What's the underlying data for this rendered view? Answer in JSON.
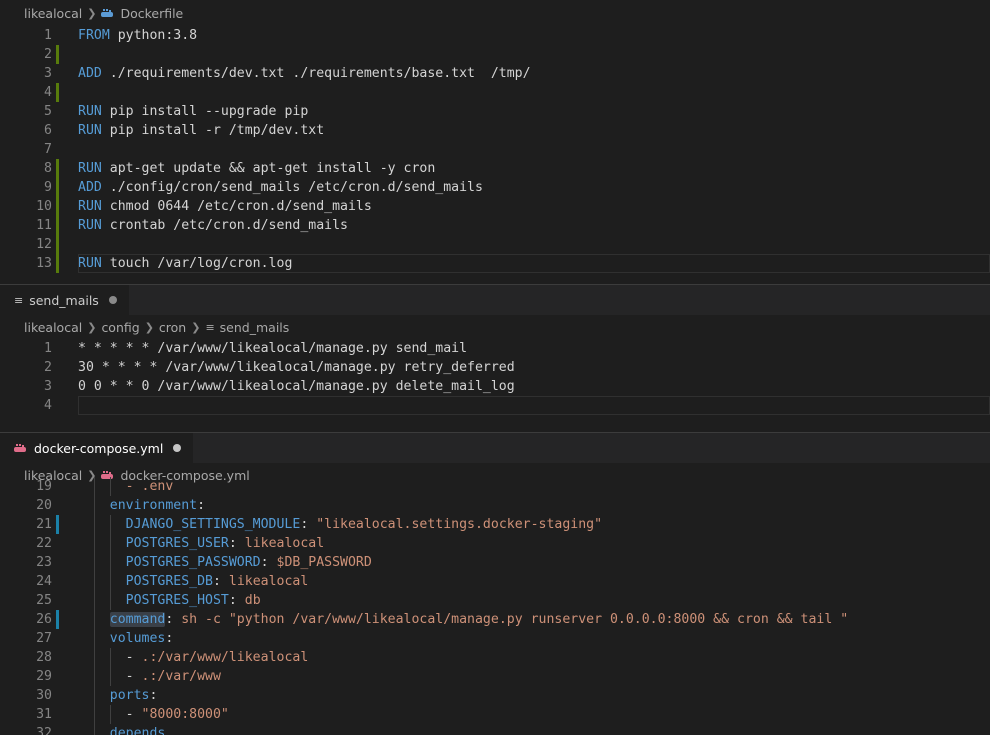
{
  "editor1": {
    "breadcrumb": {
      "folder": "likealocal",
      "file": "Dockerfile"
    },
    "lines": [
      {
        "n": "1",
        "kw": "FROM",
        "rest": " python:3.8",
        "mark": false
      },
      {
        "n": "2",
        "kw": "",
        "rest": "",
        "mark": true
      },
      {
        "n": "3",
        "kw": "ADD",
        "rest": " ./requirements/dev.txt ./requirements/base.txt  /tmp/",
        "mark": false
      },
      {
        "n": "4",
        "kw": "",
        "rest": "",
        "mark": true
      },
      {
        "n": "5",
        "kw": "RUN",
        "rest": " pip install --upgrade pip",
        "mark": false
      },
      {
        "n": "6",
        "kw": "RUN",
        "rest": " pip install -r /tmp/dev.txt",
        "mark": false
      },
      {
        "n": "7",
        "kw": "",
        "rest": "",
        "mark": false
      },
      {
        "n": "8",
        "kw": "RUN",
        "rest": " apt-get update && apt-get install -y cron",
        "mark": true
      },
      {
        "n": "9",
        "kw": "ADD",
        "rest": " ./config/cron/send_mails /etc/cron.d/send_mails",
        "mark": true
      },
      {
        "n": "10",
        "kw": "RUN",
        "rest": " chmod 0644 /etc/cron.d/send_mails",
        "mark": true
      },
      {
        "n": "11",
        "kw": "RUN",
        "rest": " crontab /etc/cron.d/send_mails",
        "mark": true
      },
      {
        "n": "12",
        "kw": "",
        "rest": "",
        "mark": true
      },
      {
        "n": "13",
        "kw": "RUN",
        "rest": " touch /var/log/cron.log",
        "mark": true
      }
    ]
  },
  "editor2": {
    "tab": {
      "label": "send_mails"
    },
    "breadcrumb": {
      "folder": "likealocal",
      "sub1": "config",
      "sub2": "cron",
      "file": "send_mails"
    },
    "lines": [
      {
        "n": "1",
        "text": "* * * * * /var/www/likealocal/manage.py send_mail"
      },
      {
        "n": "2",
        "text": "30 * * * * /var/www/likealocal/manage.py retry_deferred"
      },
      {
        "n": "3",
        "text": "0 0 * * 0 /var/www/likealocal/manage.py delete_mail_log"
      },
      {
        "n": "4",
        "text": ""
      }
    ]
  },
  "editor3": {
    "tab": {
      "label": "docker-compose.yml"
    },
    "breadcrumb": {
      "folder": "likealocal",
      "file": "docker-compose.yml"
    },
    "lines": [
      {
        "n": "19",
        "indent": "      ",
        "parts": [
          {
            "t": "- .env",
            "c": "str"
          }
        ]
      },
      {
        "n": "20",
        "indent": "    ",
        "parts": [
          {
            "t": "environment",
            "c": "key"
          },
          {
            "t": ":",
            "c": ""
          }
        ]
      },
      {
        "n": "21",
        "indent": "      ",
        "mark": "blue",
        "parts": [
          {
            "t": "DJANGO_SETTINGS_MODULE",
            "c": "key"
          },
          {
            "t": ": ",
            "c": ""
          },
          {
            "t": "\"likealocal.settings.docker-staging\"",
            "c": "str"
          }
        ]
      },
      {
        "n": "22",
        "indent": "      ",
        "parts": [
          {
            "t": "POSTGRES_USER",
            "c": "key"
          },
          {
            "t": ": ",
            "c": ""
          },
          {
            "t": "likealocal",
            "c": "str"
          }
        ]
      },
      {
        "n": "23",
        "indent": "      ",
        "parts": [
          {
            "t": "POSTGRES_PASSWORD",
            "c": "key"
          },
          {
            "t": ": ",
            "c": ""
          },
          {
            "t": "$DB_PASSWORD",
            "c": "str"
          }
        ]
      },
      {
        "n": "24",
        "indent": "      ",
        "parts": [
          {
            "t": "POSTGRES_DB",
            "c": "key"
          },
          {
            "t": ": ",
            "c": ""
          },
          {
            "t": "likealocal",
            "c": "str"
          }
        ]
      },
      {
        "n": "25",
        "indent": "      ",
        "parts": [
          {
            "t": "POSTGRES_HOST",
            "c": "key"
          },
          {
            "t": ": ",
            "c": ""
          },
          {
            "t": "db",
            "c": "str"
          }
        ]
      },
      {
        "n": "26",
        "indent": "    ",
        "mark": "blue",
        "parts": [
          {
            "t": "command",
            "c": "key hl"
          },
          {
            "t": ": ",
            "c": ""
          },
          {
            "t": "sh -c \"python /var/www/likealocal/manage.py runserver 0.0.0.0:8000 && cron && tail \"",
            "c": "str"
          }
        ]
      },
      {
        "n": "27",
        "indent": "    ",
        "parts": [
          {
            "t": "volumes",
            "c": "key"
          },
          {
            "t": ":",
            "c": ""
          }
        ]
      },
      {
        "n": "28",
        "indent": "      ",
        "parts": [
          {
            "t": "- ",
            "c": ""
          },
          {
            "t": ".:/var/www/likealocal",
            "c": "str"
          }
        ]
      },
      {
        "n": "29",
        "indent": "      ",
        "parts": [
          {
            "t": "- ",
            "c": ""
          },
          {
            "t": ".:/var/www",
            "c": "str"
          }
        ]
      },
      {
        "n": "30",
        "indent": "    ",
        "parts": [
          {
            "t": "ports",
            "c": "key"
          },
          {
            "t": ":",
            "c": ""
          }
        ]
      },
      {
        "n": "31",
        "indent": "      ",
        "parts": [
          {
            "t": "- ",
            "c": ""
          },
          {
            "t": "\"8000:8000\"",
            "c": "str"
          }
        ]
      },
      {
        "n": "32",
        "indent": "    ",
        "parts": [
          {
            "t": "depends",
            "c": "key"
          }
        ]
      }
    ]
  },
  "colors": {
    "gutter_green": "#587c0c",
    "gutter_blue": "#1b81a8",
    "dirty_dot": "#c5c5c5"
  }
}
